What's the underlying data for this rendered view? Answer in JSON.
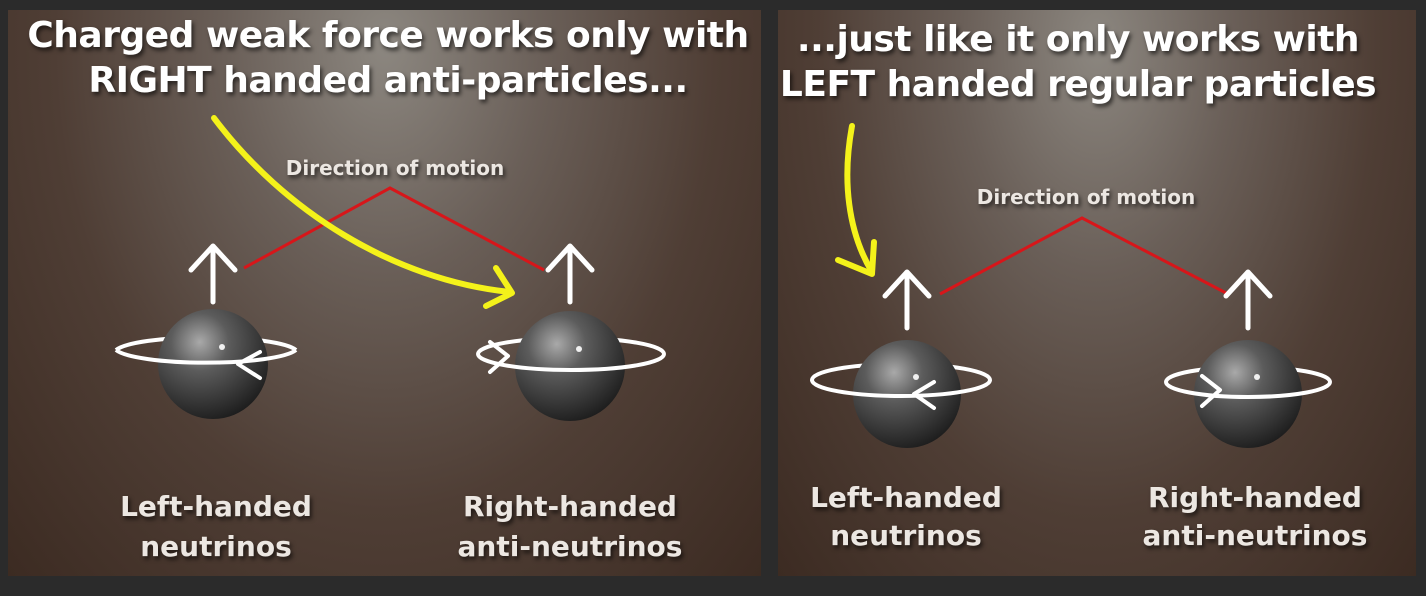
{
  "panels": [
    {
      "headline": [
        "Charged weak force works only with",
        "RIGHT handed anti-particles..."
      ],
      "direction_label": "Direction of motion",
      "particles": [
        {
          "line1": "Left-handed",
          "line2": "neutrinos"
        },
        {
          "line1": "Right-handed",
          "line2": "anti-neutrinos"
        }
      ]
    },
    {
      "headline": [
        "...just like it only works with",
        "LEFT handed regular particles"
      ],
      "direction_label": "Direction of motion",
      "particles": [
        {
          "line1": "Left-handed",
          "line2": "neutrinos"
        },
        {
          "line1": "Right-handed",
          "line2": "anti-neutrinos"
        }
      ]
    }
  ],
  "colors": {
    "pointer_arrow": "#f4f21a",
    "direction_line": "#d7161a",
    "spin_ring": "#ffffff",
    "sphere": "#4a4a4a",
    "background": "#4f3e35"
  },
  "icons": [
    "up-arrow-icon",
    "spin-ring-icon",
    "particle-sphere",
    "yellow-pointer-arrow"
  ]
}
